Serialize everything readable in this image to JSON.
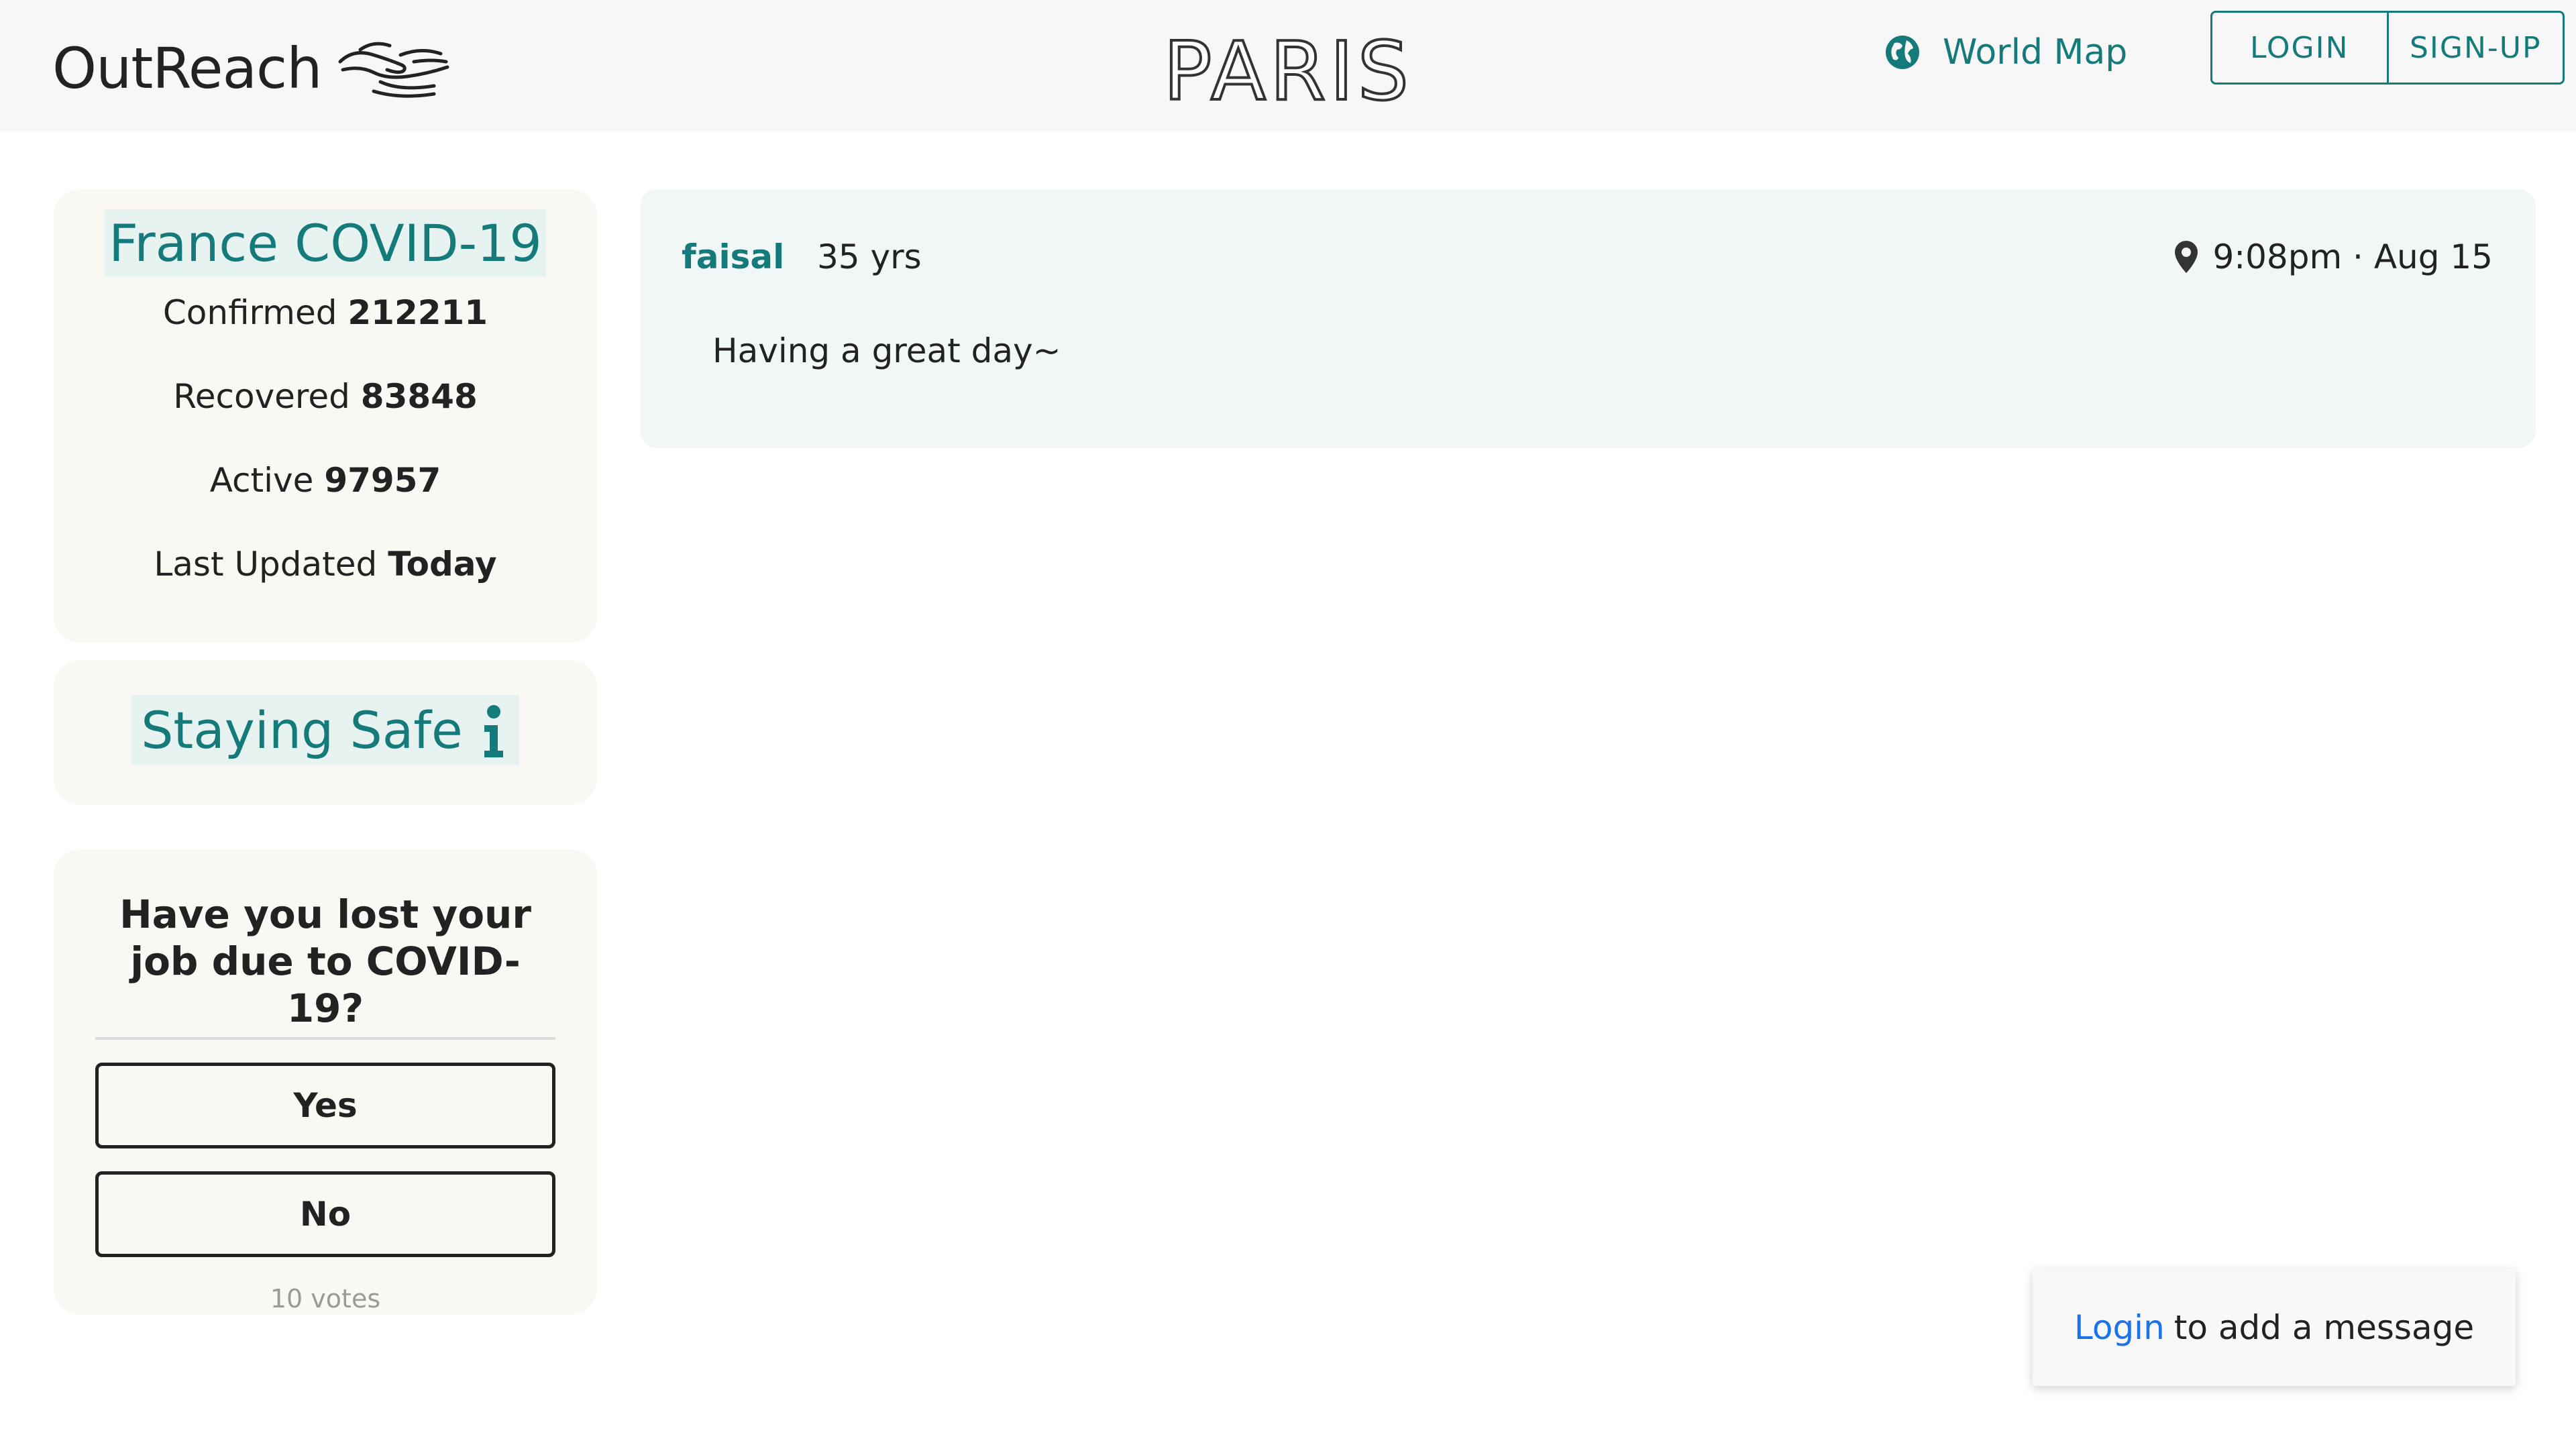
{
  "header": {
    "brand": "OutReach",
    "city": "PARIS",
    "world_map_label": "World Map",
    "login_label": "LOGIN",
    "signup_label": "SIGN-UP"
  },
  "stats": {
    "title": "France COVID-19",
    "confirmed_label": "Confirmed",
    "confirmed_value": "212211",
    "recovered_label": "Recovered",
    "recovered_value": "83848",
    "active_label": "Active",
    "active_value": "97957",
    "updated_label": "Last Updated",
    "updated_value": "Today"
  },
  "safety": {
    "title": "Staying Safe"
  },
  "poll": {
    "question": "Have you lost your job due to COVID-19?",
    "options": [
      "Yes",
      "No"
    ],
    "votes": "10 votes"
  },
  "messages": [
    {
      "user": "faisal",
      "age": "35 yrs",
      "time": "9:08pm · Aug 15",
      "text": "Having a great day~"
    }
  ],
  "toast": {
    "link": "Login",
    "text": "to add a message"
  },
  "colors": {
    "accent": "#147a7a",
    "link": "#1a73e8",
    "card_bg": "#faf8f2",
    "message_bg": "#f1f6f6"
  }
}
